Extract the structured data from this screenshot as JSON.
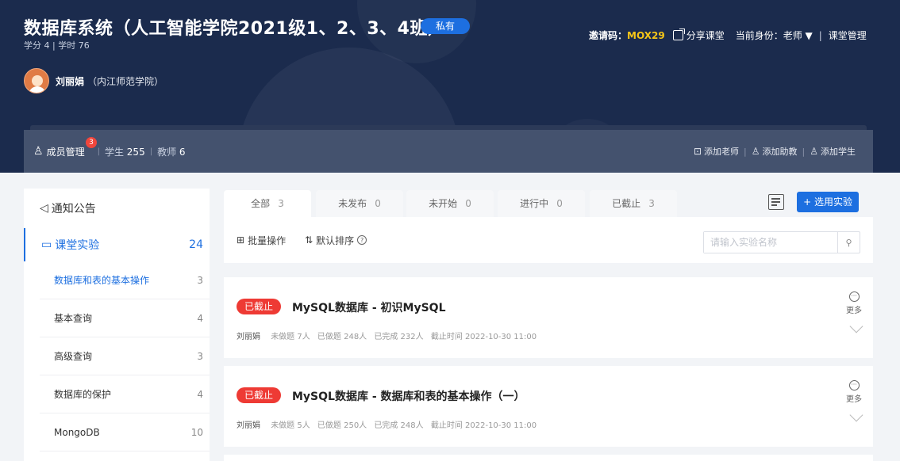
{
  "header": {
    "course_title": "数据库系统（人工智能学院2021级1、2、3、4班）",
    "private_badge": "私有",
    "course_meta": "学分 4 | 学时 76",
    "teacher_name": "刘丽娟",
    "teacher_school": "（内江师范学院）",
    "invite_label": "邀请码：",
    "invite_code": "MOX29",
    "share_label": "分享课堂",
    "role_label": "当前身份：老师 ▼",
    "manage_label": "课堂管理",
    "separator": "|"
  },
  "member_bar": {
    "member_manage_label": "成员管理",
    "member_badge": "3",
    "students_label": "学生",
    "students_count": "255",
    "teachers_label": "教师",
    "teachers_count": "6",
    "add_teacher": "添加老师",
    "add_assistant": "添加助教",
    "add_student": "添加学生"
  },
  "sidebar": {
    "notice_label": "通知公告",
    "experiments_label": "课堂实验",
    "experiments_count": "24",
    "items": [
      {
        "label": "数据库和表的基本操作",
        "count": "3"
      },
      {
        "label": "基本查询",
        "count": "4"
      },
      {
        "label": "高级查询",
        "count": "3"
      },
      {
        "label": "数据库的保护",
        "count": "4"
      },
      {
        "label": "MongoDB",
        "count": "10"
      }
    ]
  },
  "main": {
    "tabs": [
      {
        "label": "全部",
        "count": "3"
      },
      {
        "label": "未发布",
        "count": "0"
      },
      {
        "label": "未开始",
        "count": "0"
      },
      {
        "label": "进行中",
        "count": "0"
      },
      {
        "label": "已截止",
        "count": "3"
      }
    ],
    "select_experiment_button": "+ 选用实验",
    "batch_action": "批量操作",
    "default_sort": "默认排序",
    "search_placeholder": "请输入实验名称",
    "more_label": "更多",
    "cards": [
      {
        "status": "已截止",
        "title": "MySQL数据库 - 初识MySQL",
        "author": "刘丽娟",
        "not_done": "未做题 7人",
        "done": "已做题 248人",
        "completed": "已完成 232人",
        "deadline": "截止时间 2022-10-30 11:00"
      },
      {
        "status": "已截止",
        "title": "MySQL数据库 - 数据库和表的基本操作（一）",
        "author": "刘丽娟",
        "not_done": "未做题 5人",
        "done": "已做题 250人",
        "completed": "已完成 248人",
        "deadline": "截止时间 2022-10-30 11:00"
      }
    ]
  }
}
